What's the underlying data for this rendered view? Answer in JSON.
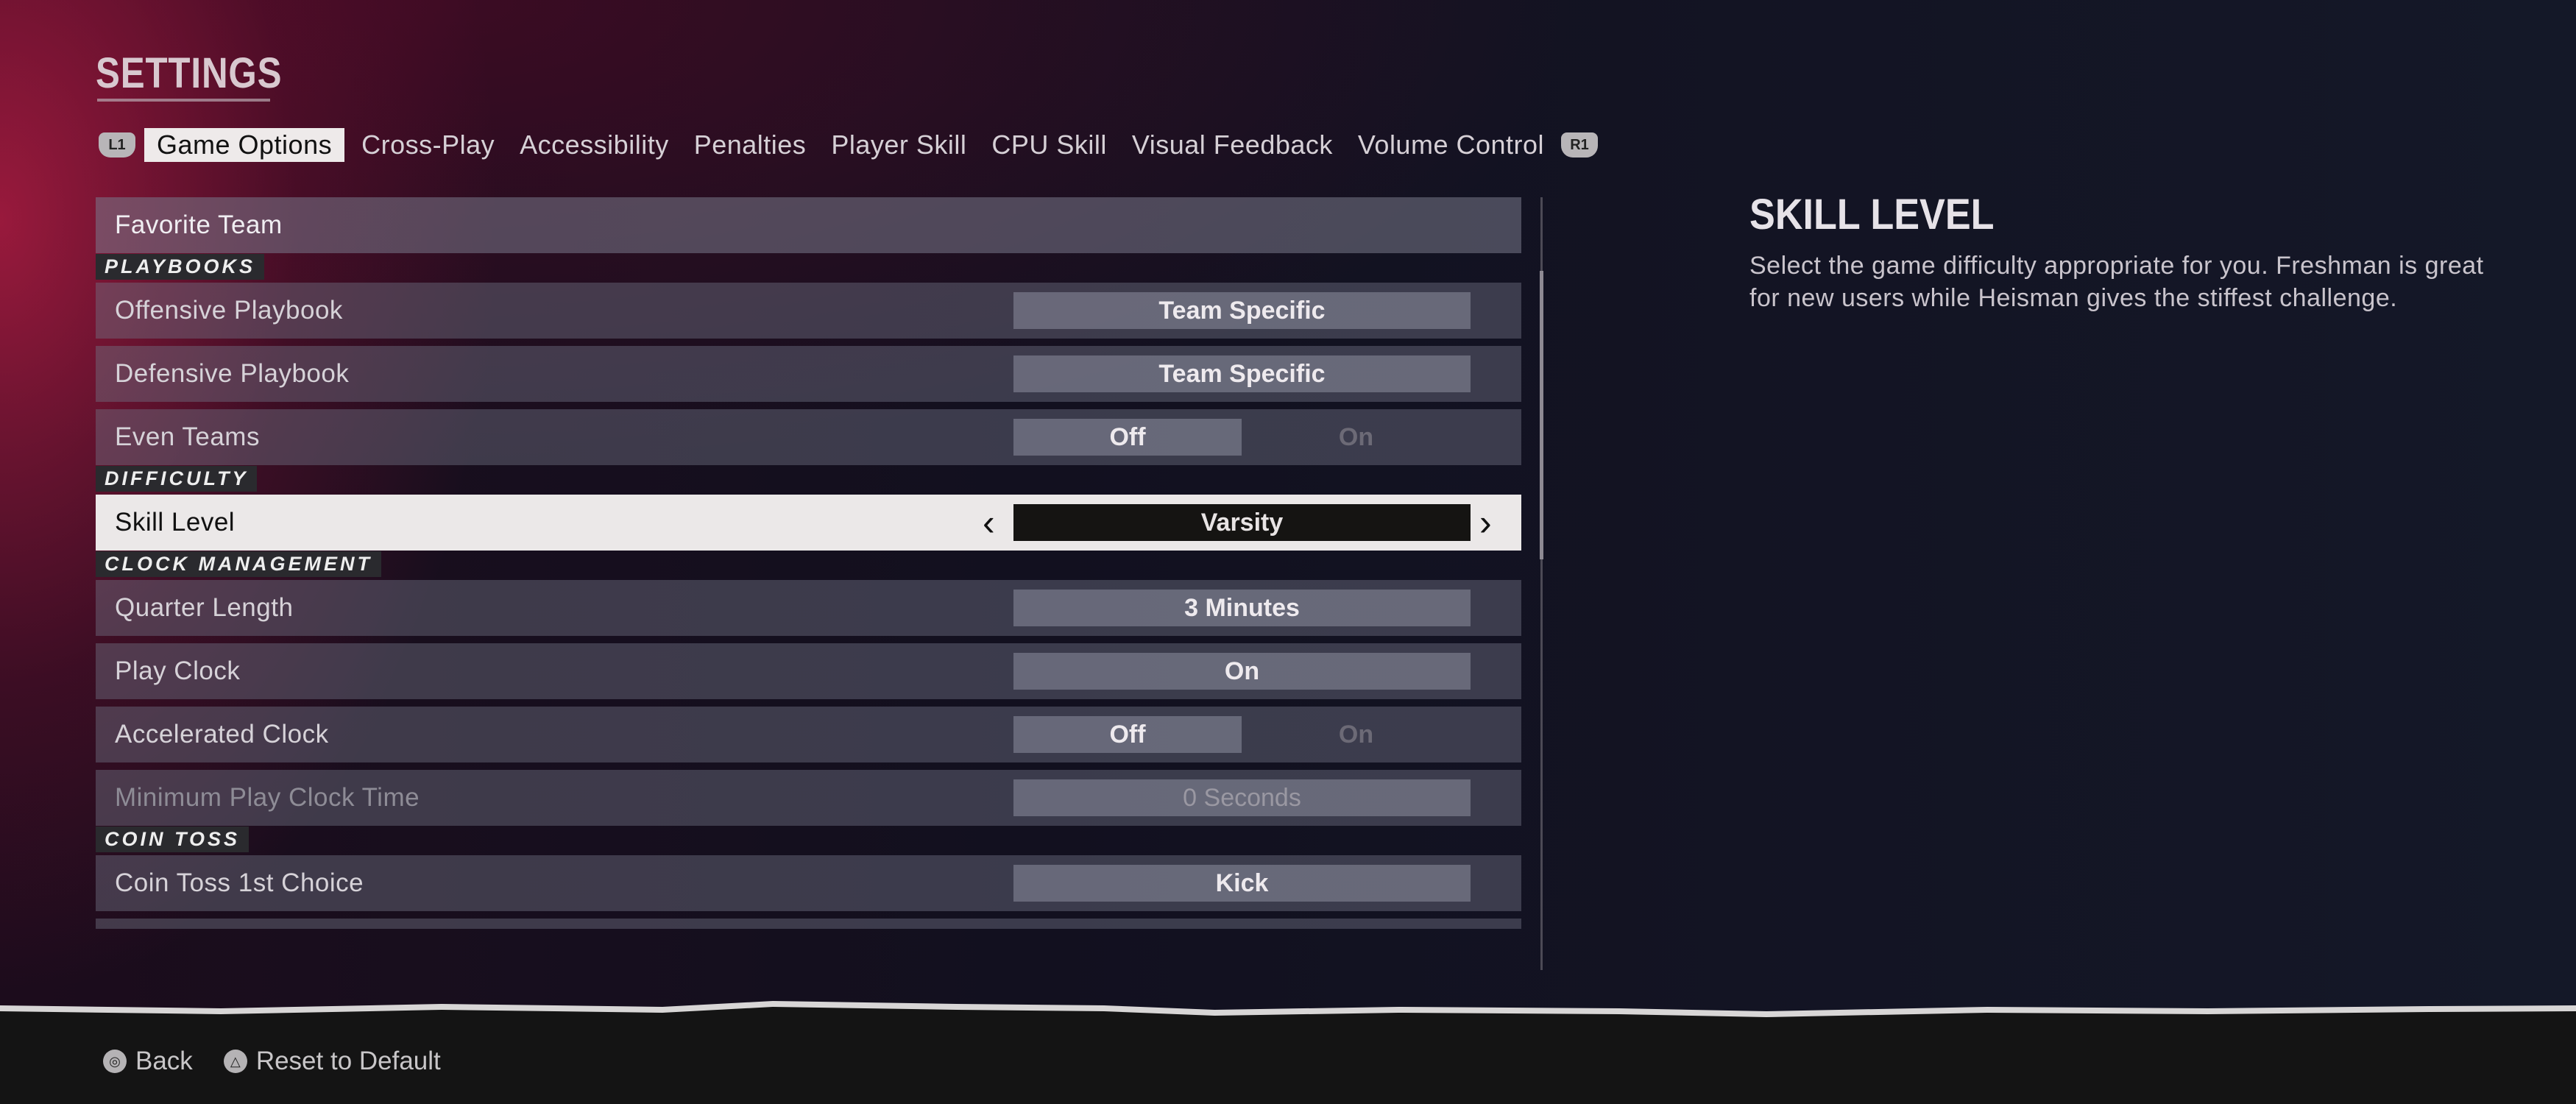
{
  "header": {
    "title": "SETTINGS"
  },
  "tabs": {
    "left_bumper": "L1",
    "right_bumper": "R1",
    "items": [
      "Game Options",
      "Cross-Play",
      "Accessibility",
      "Penalties",
      "Player Skill",
      "CPU Skill",
      "Visual Feedback",
      "Volume Control"
    ],
    "active": "Game Options"
  },
  "list": [
    {
      "type": "row",
      "kind": "header",
      "label": "Favorite Team"
    },
    {
      "type": "section",
      "label": "PLAYBOOKS"
    },
    {
      "type": "row",
      "kind": "value",
      "label": "Offensive Playbook",
      "value": "Team Specific"
    },
    {
      "type": "row",
      "kind": "value",
      "label": "Defensive Playbook",
      "value": "Team Specific"
    },
    {
      "type": "row",
      "kind": "toggle",
      "label": "Even Teams",
      "off": "Off",
      "on": "On",
      "selected": "Off"
    },
    {
      "type": "section",
      "label": "DIFFICULTY"
    },
    {
      "type": "row",
      "kind": "selected",
      "label": "Skill Level",
      "value": "Varsity"
    },
    {
      "type": "section",
      "label": "CLOCK MANAGEMENT"
    },
    {
      "type": "row",
      "kind": "value",
      "label": "Quarter Length",
      "value": "3 Minutes"
    },
    {
      "type": "row",
      "kind": "value",
      "label": "Play Clock",
      "value": "On"
    },
    {
      "type": "row",
      "kind": "toggle",
      "label": "Accelerated Clock",
      "off": "Off",
      "on": "On",
      "selected": "Off"
    },
    {
      "type": "row",
      "kind": "disabled",
      "label": "Minimum Play Clock Time",
      "value": "0 Seconds"
    },
    {
      "type": "section",
      "label": "COIN TOSS"
    },
    {
      "type": "row",
      "kind": "value",
      "label": "Coin Toss 1st Choice",
      "value": "Kick"
    },
    {
      "type": "row",
      "kind": "partial",
      "label": ""
    }
  ],
  "help": {
    "title": "SKILL LEVEL",
    "description": "Select the game difficulty appropriate for you. Freshman is great for new users while Heisman gives the stiffest challenge."
  },
  "footer": {
    "hints": [
      {
        "icon": "circle-button-icon",
        "glyph": "◎",
        "label": "Back"
      },
      {
        "icon": "triangle-button-icon",
        "glyph": "△",
        "label": "Reset to Default"
      }
    ]
  },
  "colors": {
    "selected_row": "#ebe8e8",
    "selected_value_bg": "#151412",
    "accent_red": "#be1e46"
  }
}
